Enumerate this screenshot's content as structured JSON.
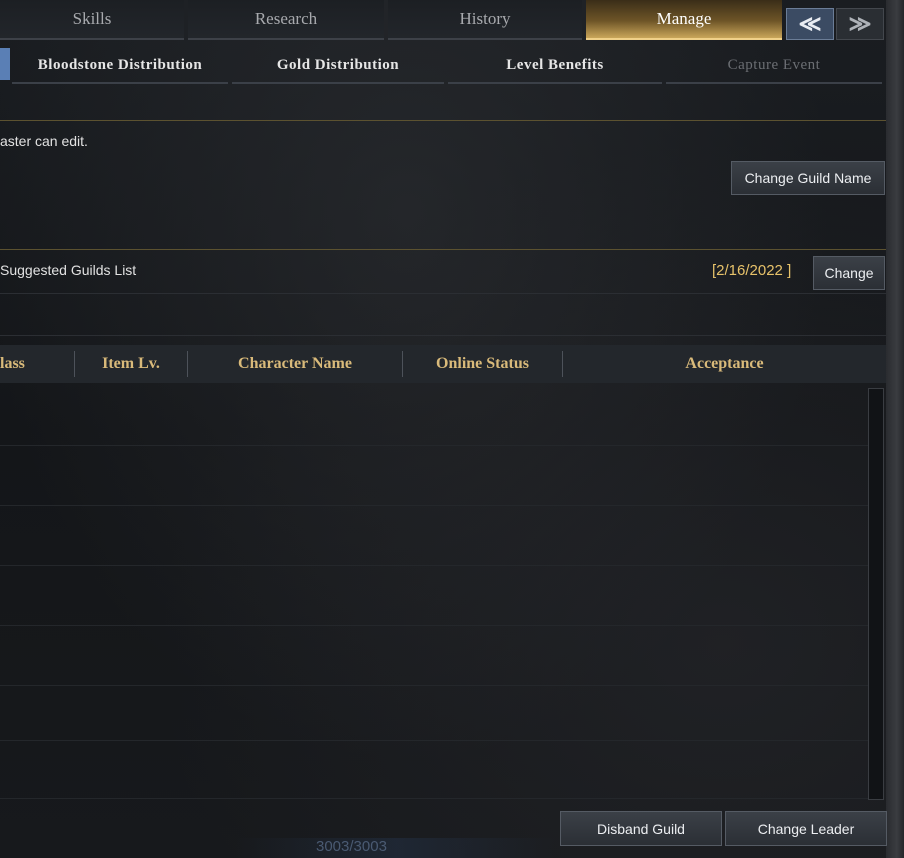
{
  "top_tabs": [
    {
      "label": "Skills"
    },
    {
      "label": "Research"
    },
    {
      "label": "History"
    },
    {
      "label": "Manage"
    }
  ],
  "nav": {
    "first": "≪",
    "next": "≫"
  },
  "sub_tabs": [
    {
      "label": "Bloodstone Distribution"
    },
    {
      "label": "Gold Distribution"
    },
    {
      "label": "Level Benefits"
    },
    {
      "label": "Capture Event"
    }
  ],
  "guild_name": {
    "note": "aster can edit.",
    "change_button": "Change Guild Name"
  },
  "suggested": {
    "label": "Suggested Guilds List",
    "date": "[2/16/2022 ]",
    "change_button": "Change"
  },
  "table": {
    "columns": [
      "lass",
      "Item Lv.",
      "Character Name",
      "Online Status",
      "Acceptance"
    ],
    "rows": []
  },
  "actions": {
    "disband": "Disband Guild",
    "change_leader": "Change Leader"
  },
  "footer": {
    "counter": "3003/3003"
  },
  "colors": {
    "accent_gold": "#d9ba7a",
    "date_gold": "#e7c26a",
    "active_tab": "#c9a55a",
    "nav_blue": "#3b4b63"
  }
}
